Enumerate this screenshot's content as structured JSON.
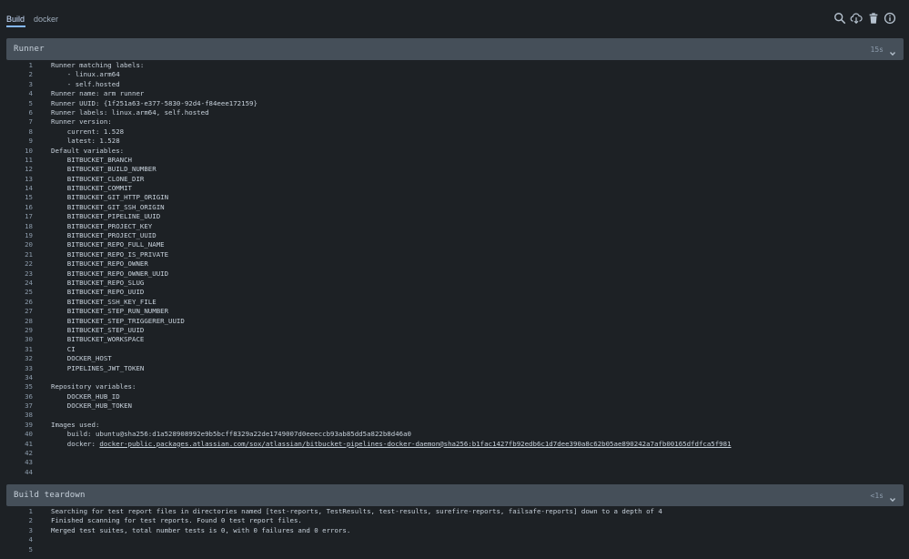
{
  "tabs": [
    {
      "label": "Build",
      "active": true
    },
    {
      "label": "docker",
      "active": false
    }
  ],
  "toolbar_icons": [
    "search-icon",
    "cloud-download-icon",
    "trash-icon",
    "info-icon"
  ],
  "sections": [
    {
      "title": "Runner",
      "duration": "15s",
      "lines": [
        "Runner matching labels:",
        "    - linux.arm64",
        "    - self.hosted",
        "Runner name: arm runner",
        "Runner UUID: {1f251a63-e377-5830-92d4-f84eee172159}",
        "Runner labels: linux.arm64, self.hosted",
        "Runner version:",
        "    current: 1.528",
        "    latest: 1.528",
        "Default variables:",
        "    BITBUCKET_BRANCH",
        "    BITBUCKET_BUILD_NUMBER",
        "    BITBUCKET_CLONE_DIR",
        "    BITBUCKET_COMMIT",
        "    BITBUCKET_GIT_HTTP_ORIGIN",
        "    BITBUCKET_GIT_SSH_ORIGIN",
        "    BITBUCKET_PIPELINE_UUID",
        "    BITBUCKET_PROJECT_KEY",
        "    BITBUCKET_PROJECT_UUID",
        "    BITBUCKET_REPO_FULL_NAME",
        "    BITBUCKET_REPO_IS_PRIVATE",
        "    BITBUCKET_REPO_OWNER",
        "    BITBUCKET_REPO_OWNER_UUID",
        "    BITBUCKET_REPO_SLUG",
        "    BITBUCKET_REPO_UUID",
        "    BITBUCKET_SSH_KEY_FILE",
        "    BITBUCKET_STEP_RUN_NUMBER",
        "    BITBUCKET_STEP_TRIGGERER_UUID",
        "    BITBUCKET_STEP_UUID",
        "    BITBUCKET_WORKSPACE",
        "    CI",
        "    DOCKER_HOST",
        "    PIPELINES_JWT_TOKEN",
        "",
        "Repository variables:",
        "    DOCKER_HUB_ID",
        "    DOCKER_HUB_TOKEN",
        "",
        "Images used:",
        "    build: ubuntu@sha256:d1a528908992e9b5bcff8329a22de1749007d0eeeccb93ab85dd5a822b8d46a0",
        {
          "prefix": "    docker: ",
          "link": "docker-public.packages.atlassian.com/sox/atlassian/bitbucket-pipelines-docker-daemon@sha256:b1fac1427fb92edb6c1d7dee390a8c62b05ae890242a7afb00165dfdfca5f981"
        },
        "",
        "",
        ""
      ]
    },
    {
      "title": "Build teardown",
      "duration": "<1s",
      "lines": [
        "Searching for test report files in directories named [test-reports, TestResults, test-results, surefire-reports, failsafe-reports] down to a depth of 4",
        "Finished scanning for test reports. Found 0 test report files.",
        "Merged test suites, total number tests is 0, with 0 failures and 0 errors.",
        "",
        ""
      ]
    }
  ],
  "colors": {
    "background": "#1d2125",
    "section_header": "#454f59",
    "active_tab": "#cce0ff",
    "accent": "#85b8ff"
  }
}
